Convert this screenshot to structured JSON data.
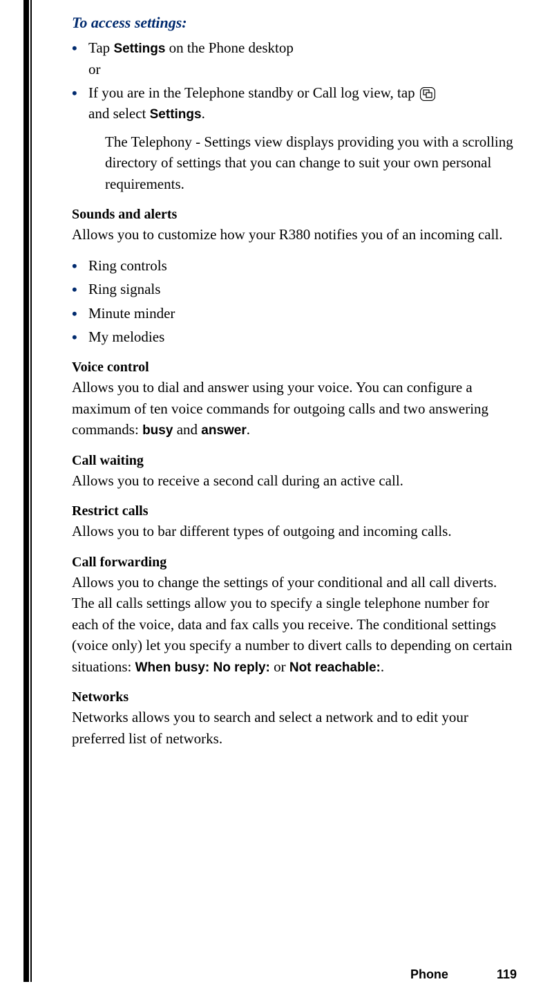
{
  "intro_heading": "To access settings:",
  "bullet1_a": "Tap ",
  "bullet1_bold": "Settings",
  "bullet1_b": " on the Phone desktop",
  "bullet1_or": "or",
  "bullet2_a": "If you are in the Telephone standby or Call log view, tap ",
  "bullet2_b": "and select ",
  "bullet2_bold": "Settings",
  "bullet2_c": ".",
  "indent_text": "The Telephony - Settings view displays providing you with a scrolling directory of settings that you can change to suit your own personal requirements.",
  "sections": {
    "sounds": {
      "title": "Sounds and alerts",
      "body": "Allows you to customize how your R380 notifies you of an incoming call.",
      "items": [
        "Ring controls",
        "Ring signals",
        "Minute minder",
        "My melodies"
      ]
    },
    "voice": {
      "title": "Voice control",
      "body_a": "Allows you to dial and answer using your voice. You can configure a maximum of ten voice commands for outgoing calls and two answering commands: ",
      "busy": "busy",
      "and": " and ",
      "answer": "answer",
      "period": "."
    },
    "waiting": {
      "title": "Call waiting",
      "body": "Allows you to receive a second call during an active call."
    },
    "restrict": {
      "title": "Restrict calls",
      "body": "Allows you to bar different types of outgoing and incoming calls."
    },
    "forwarding": {
      "title": "Call forwarding",
      "body_a": "Allows you to change the settings of your conditional and all call diverts. The all calls settings allow you to specify a single telephone number for each of the voice, data and fax calls you receive. The conditional settings (voice only) let you specify a number to divert calls to depending on certain situations: ",
      "when_busy": "When busy:",
      "sp1": " ",
      "no_reply": "No reply:",
      "or": " or ",
      "not_reach": "Not reachable:",
      "period": "."
    },
    "networks": {
      "title": "Networks",
      "body": "Networks allows you to search and select a network and to edit your preferred list of networks."
    }
  },
  "footer": {
    "label": "Phone",
    "page": "119"
  }
}
